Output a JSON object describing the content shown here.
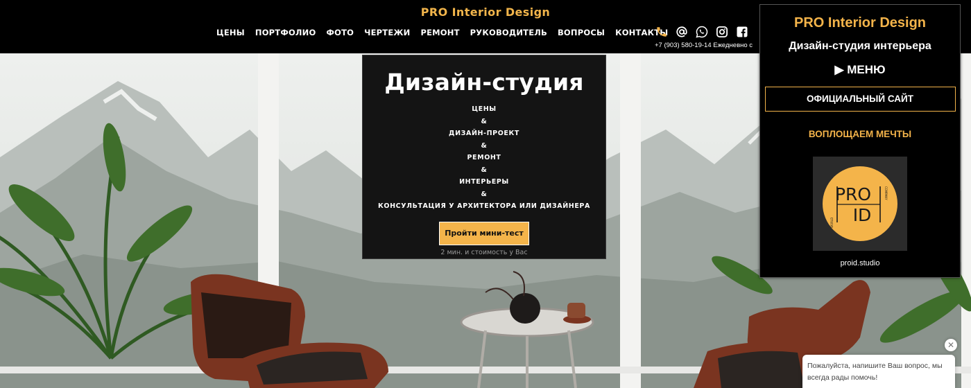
{
  "header": {
    "brand": "PRO Interior Design",
    "nav": [
      "ЦЕНЫ",
      "ПОРТФОЛИО",
      "ФОТО",
      "ЧЕРТЕЖИ",
      "РЕМОНТ",
      "РУКОВОДИТЕЛЬ",
      "ВОПРОСЫ",
      "КОНТАКТЫ"
    ],
    "contact_line": "+7 (903) 580-19-14 Ежедневно с",
    "icons": [
      "phone-icon",
      "email-at-icon",
      "whatsapp-icon",
      "instagram-icon",
      "facebook-icon"
    ]
  },
  "hero": {
    "title": "Дизайн-студия",
    "lines": [
      "ЦЕНЫ",
      "&",
      "ДИЗАЙН-ПРОЕКТ",
      "&",
      "РЕМОНТ",
      "&",
      "ИНТЕРЬЕРЫ",
      "&",
      "КОНСУЛЬТАЦИЯ У АРХИТЕКТОРА ИЛИ ДИЗАЙНЕРА"
    ],
    "button_label": "Пройти мини-тест",
    "note": "2 мин. и стоимость у Вас"
  },
  "panel": {
    "title": "PRO Interior Design",
    "subtitle": "Дизайн-студия интерьера",
    "menu_label": "▶ МЕНЮ",
    "site_button": "ОФИЦИАЛЬНЫЙ САЙТ",
    "slogan": "ВОПЛОЩАЕМ МЕЧТЫ",
    "logo_text_pro": "PRO",
    "logo_text_id": "ID",
    "logo_small_top": "COMPANY",
    "logo_small_bottom": "WORLD",
    "domain": "proid.studio"
  },
  "chat": {
    "message": "Пожалуйста, напишите Ваш вопрос, мы всегда рады помочь!",
    "close": "✕"
  },
  "colors": {
    "accent": "#f4b44a",
    "header_bg": "#000000",
    "card_bg": "#141414"
  }
}
